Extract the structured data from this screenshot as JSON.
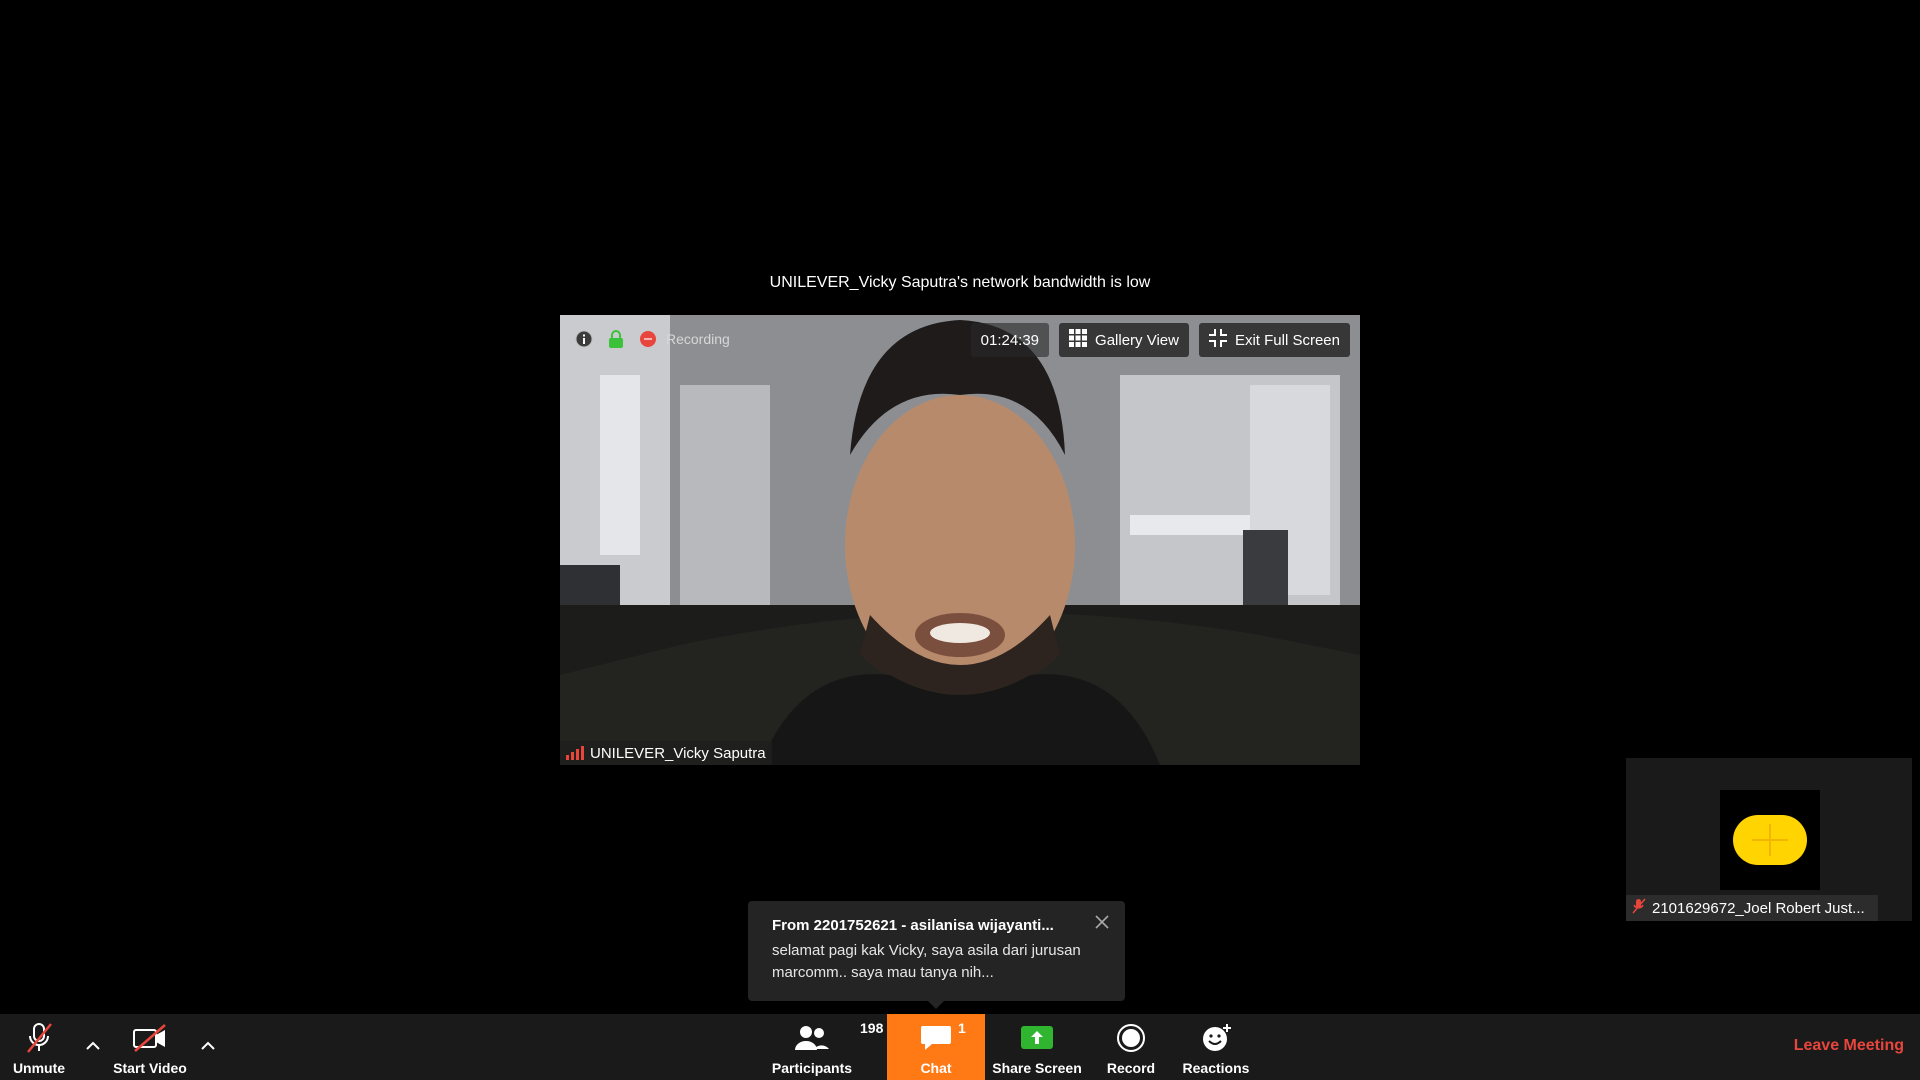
{
  "notice": {
    "bandwidth": "UNILEVER_Vicky Saputra's network bandwidth is low"
  },
  "video": {
    "recording_label": "Recording",
    "timer": "01:24:39",
    "gallery_view_label": "Gallery View",
    "exit_fullscreen_label": "Exit Full Screen",
    "speaker_name": "UNILEVER_Vicky Saputra"
  },
  "self_view": {
    "name": "2101629672_Joel Robert Just..."
  },
  "chat_toast": {
    "from": "From 2201752621 - asilanisa wijayanti...",
    "message": "selamat pagi kak Vicky, saya asila dari jurusan marcomm.. saya mau tanya nih..."
  },
  "toolbar": {
    "unmute_label": "Unmute",
    "start_video_label": "Start Video",
    "participants_label": "Participants",
    "participants_count": "198",
    "chat_label": "Chat",
    "chat_count": "1",
    "share_screen_label": "Share Screen",
    "record_label": "Record",
    "reactions_label": "Reactions",
    "leave_label": "Leave Meeting"
  },
  "colors": {
    "chat_active": "#ff7a14",
    "leave": "#e8453c",
    "share_green": "#2fb52f",
    "avatar_yellow": "#ffd400"
  }
}
